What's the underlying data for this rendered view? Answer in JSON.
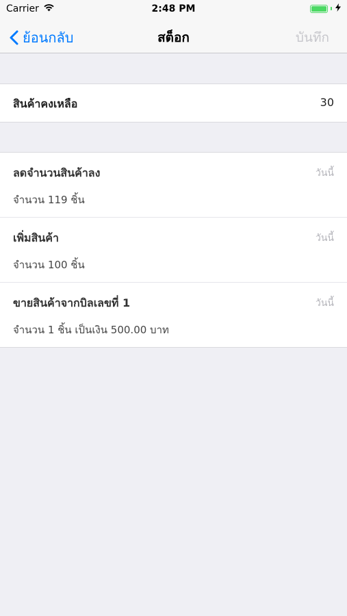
{
  "status_bar": {
    "carrier": "Carrier",
    "time": "2:48 PM",
    "battery_level": 1.0,
    "battery_color": "#4cd964"
  },
  "nav": {
    "back_label": "ย้อนกลับ",
    "title": "สต็อก",
    "save_label": "บันทึก",
    "accent_color": "#007aff"
  },
  "stock": {
    "label": "สินค้าคงเหลือ",
    "value": "30"
  },
  "history": [
    {
      "title": "ลดจำนวนสินค้าลง",
      "date": "วันนี้",
      "detail": "จำนวน 119 ชิ้น"
    },
    {
      "title": "เพิ่มสินค้า",
      "date": "วันนี้",
      "detail": "จำนวน 100 ชิ้น"
    },
    {
      "title": "ขายสินค้าจากบิลเลขที่ 1",
      "date": "วันนี้",
      "detail": "จำนวน 1 ชิ้น เป็นเงิน 500.00 บาท"
    }
  ]
}
